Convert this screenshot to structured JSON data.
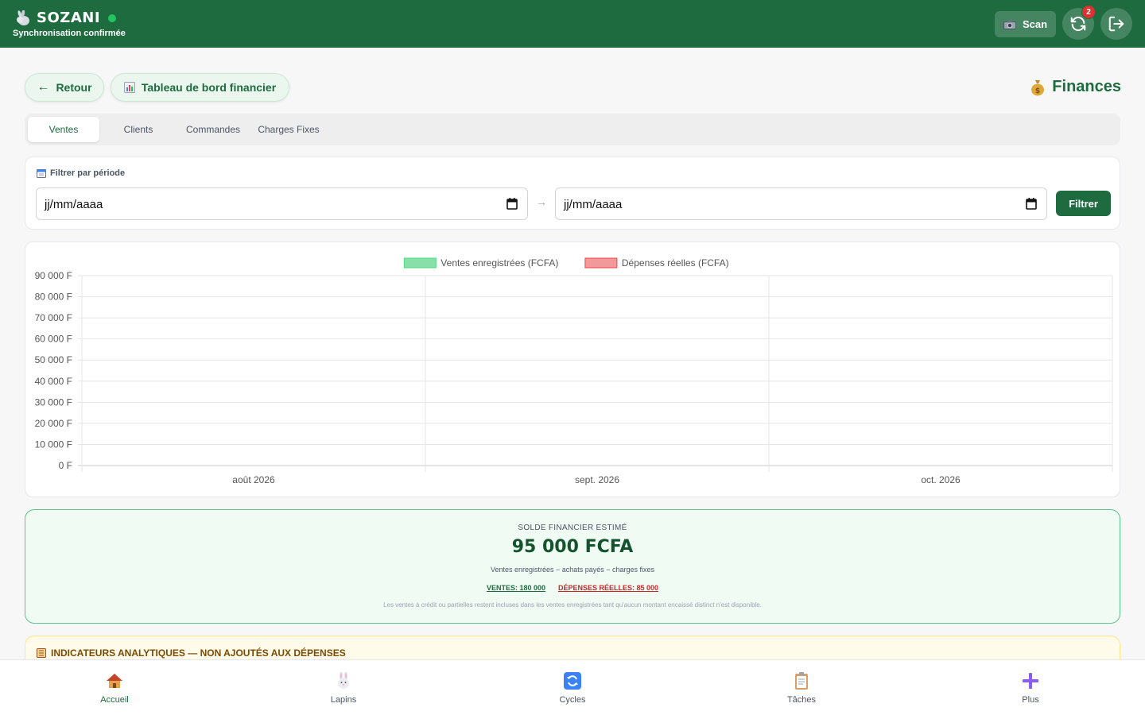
{
  "header": {
    "brand_name": "SOZANI",
    "sync_status": "Synchronisation confirmée",
    "scan_label": "Scan",
    "sync_badge": "2",
    "colors": {
      "primary": "#1e6b3f",
      "online": "#22c55e",
      "badge": "#e03131"
    }
  },
  "nav": {
    "back_label": "Retour",
    "dashboard_label": "Tableau de bord financier",
    "page_title": "Finances"
  },
  "tabs": [
    {
      "label": "Ventes",
      "active": true
    },
    {
      "label": "Clients",
      "active": false
    },
    {
      "label": "Commandes",
      "active": false
    },
    {
      "label": "Charges Fixes",
      "active": false
    }
  ],
  "filter": {
    "label": "Filtrer par période",
    "from_value": "jj/mm/aaaa",
    "to_value": "jj/mm/aaaa",
    "button_label": "Filtrer"
  },
  "chart_data": {
    "type": "bar",
    "categories": [
      "août 2026",
      "sept. 2026",
      "oct. 2026"
    ],
    "series": [
      {
        "name": "Ventes enregistrées (FCFA)",
        "color": "#86e0a8",
        "values": [
          0,
          0,
          0
        ]
      },
      {
        "name": "Dépenses réelles (FCFA)",
        "color": "#f3999b",
        "values": [
          0,
          0,
          0
        ]
      }
    ],
    "y_ticks": [
      "0 F",
      "10 000 F",
      "20 000 F",
      "30 000 F",
      "40 000 F",
      "50 000 F",
      "60 000 F",
      "70 000 F",
      "80 000 F",
      "90 000 F"
    ],
    "ylim": [
      0,
      90000
    ],
    "grid": true,
    "legend": "top-center"
  },
  "balance": {
    "label": "SOLDE FINANCIER ESTIMÉ",
    "value": "95 000 FCFA",
    "formula": "Ventes enregistrées − achats payés − charges fixes",
    "sales": "VENTES: 180 000",
    "expenses": "DÉPENSES RÉELLES: 85 000",
    "note": "Les ventes à crédit ou partielles restent incluses dans les ventes enregistrées tant qu'aucun montant encaissé distinct n'est disponible."
  },
  "analytics": {
    "title": "INDICATEURS ANALYTIQUES — NON AJOUTÉS AUX DÉPENSES"
  },
  "bottom_nav": [
    {
      "label": "Accueil",
      "icon": "house-icon",
      "active": true
    },
    {
      "label": "Lapins",
      "icon": "rabbit-icon",
      "active": false
    },
    {
      "label": "Cycles",
      "icon": "cycle-icon",
      "active": false
    },
    {
      "label": "Tâches",
      "icon": "clipboard-icon",
      "active": false
    },
    {
      "label": "Plus",
      "icon": "plus-icon",
      "active": false
    }
  ]
}
